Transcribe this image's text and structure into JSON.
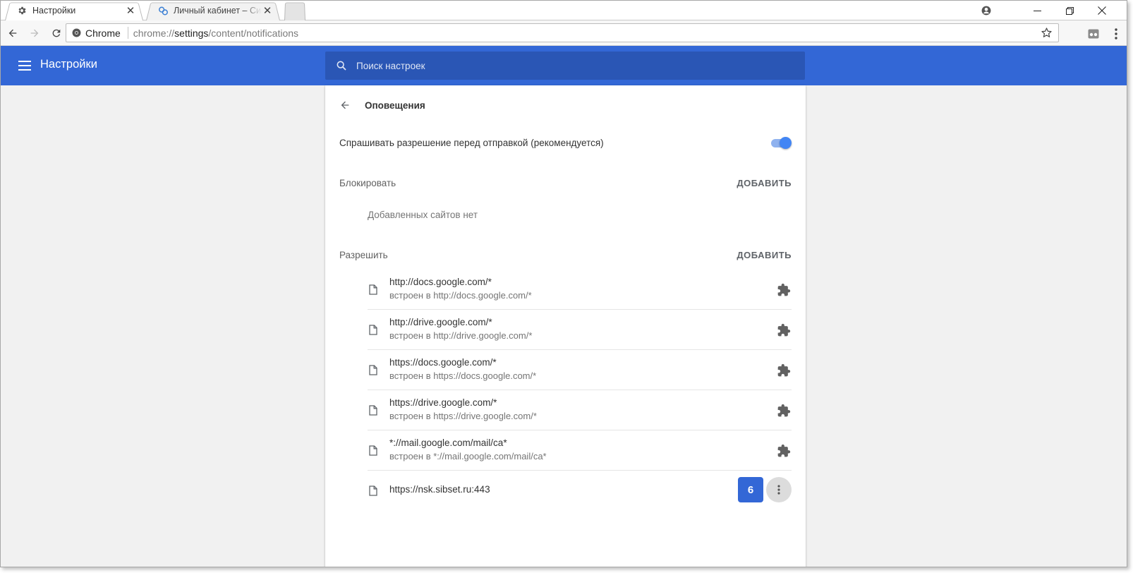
{
  "tabs": [
    {
      "title": "Настройки",
      "icon": "gear-icon",
      "active": true
    },
    {
      "title": "Личный кабинет – Сибирские сети",
      "icon": "sibset-icon",
      "active": false
    }
  ],
  "toolbar": {
    "chip_label": "Chrome",
    "url_scheme": "chrome://",
    "url_host": "settings",
    "url_path": "/content/notifications"
  },
  "header": {
    "title": "Настройки",
    "search_placeholder": "Поиск настроек"
  },
  "page": {
    "title": "Оповещения",
    "ask_label": "Спрашивать разрешение перед отправкой (рекомендуется)",
    "ask_enabled": true,
    "block": {
      "label": "Блокировать",
      "add_label": "ДОБАВИТЬ",
      "empty_text": "Добавленных сайтов нет"
    },
    "allow": {
      "label": "Разрешить",
      "add_label": "ДОБАВИТЬ",
      "sites": [
        {
          "url": "http://docs.google.com/*",
          "sub": "встроен в http://docs.google.com/*"
        },
        {
          "url": "http://drive.google.com/*",
          "sub": "встроен в http://drive.google.com/*"
        },
        {
          "url": "https://docs.google.com/*",
          "sub": "встроен в https://docs.google.com/*"
        },
        {
          "url": "https://drive.google.com/*",
          "sub": "встроен в https://drive.google.com/*"
        },
        {
          "url": "*://mail.google.com/mail/ca*",
          "sub": "встроен в *://mail.google.com/mail/ca*"
        },
        {
          "url": "https://nsk.sibset.ru:443",
          "sub": ""
        }
      ],
      "badge": "6"
    }
  },
  "colors": {
    "header_blue": "#3367d6",
    "search_blue": "#2a56b5",
    "toggle_on": "#4285f4"
  }
}
